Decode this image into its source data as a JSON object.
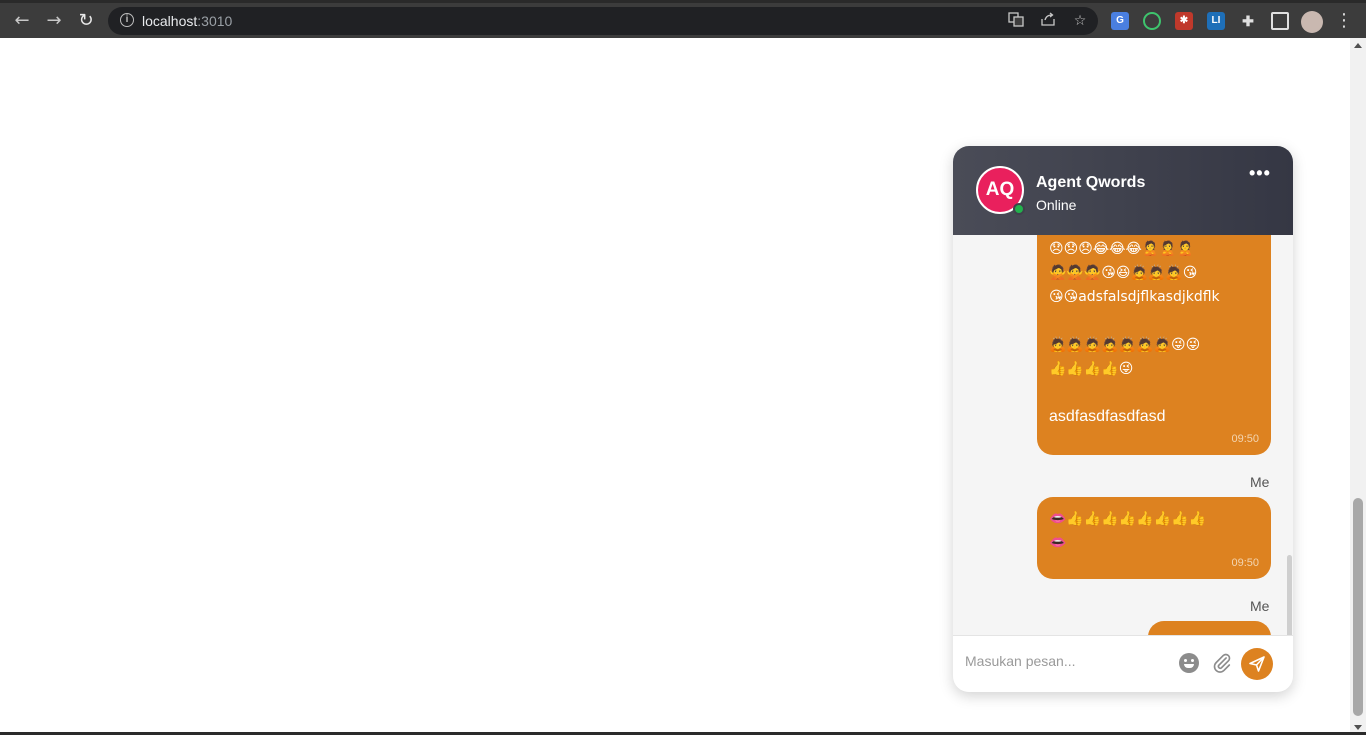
{
  "browser": {
    "url_host": "localhost",
    "url_port": ":3010"
  },
  "chat": {
    "avatar_initials": "AQ",
    "agent_name": "Agent Qwords",
    "agent_status": "Online",
    "messages": [
      {
        "lines": [
          "😞😞😞😂😂😂🙎🙎🙎",
          "🙅🙅🙅😘😆🙇🙇🙇😘",
          "😘😘adsfalsdjflkasdjkdflk",
          "",
          "🙇🙇🙇🙇🙇🙇🙇😜😜",
          "👍👍👍👍😜"
        ],
        "trailing_text": "asdfasdfasdfasd",
        "time": "09:50"
      },
      {
        "sender": "Me",
        "lines": [
          "👄👍👍👍👍👍👍👍👍",
          "👄"
        ],
        "time": "09:50"
      },
      {
        "sender": "Me"
      }
    ],
    "input_placeholder": "Masukan pesan..."
  },
  "colors": {
    "accent": "#dd8220",
    "avatar": "#e9205d",
    "online": "#22b14c",
    "header": "#3f414c"
  }
}
